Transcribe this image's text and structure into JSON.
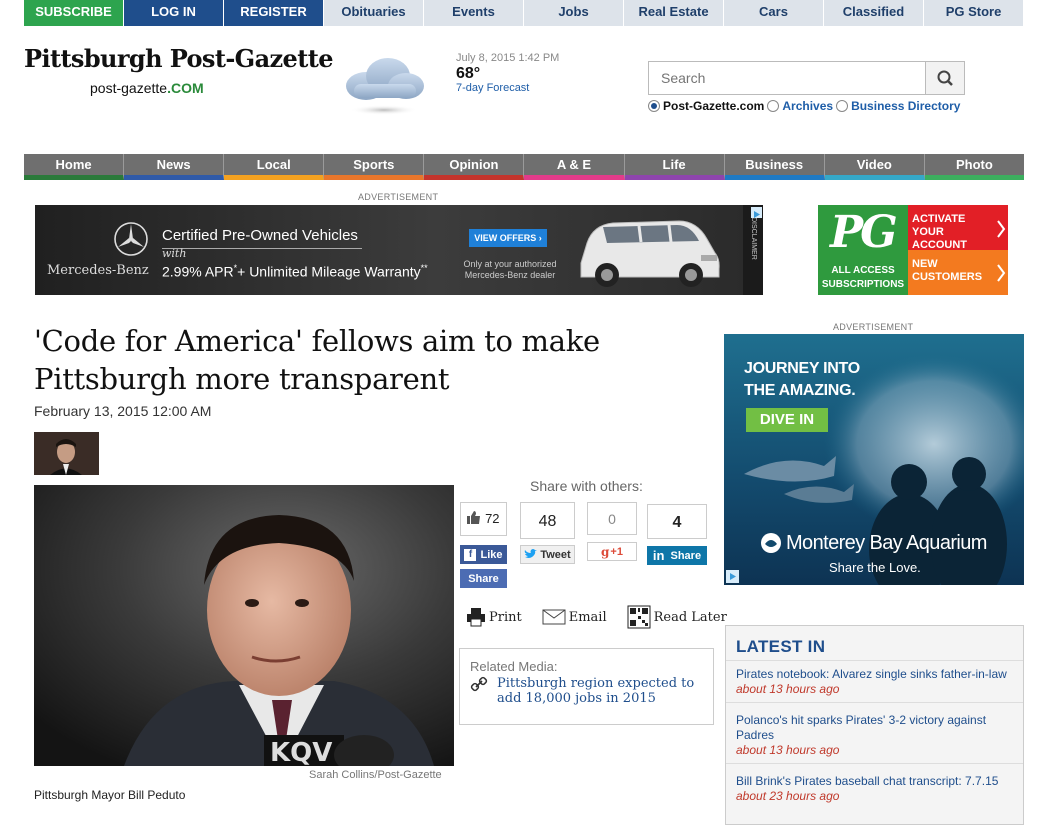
{
  "topnav": {
    "items": [
      "SUBSCRIBE",
      "LOG IN",
      "REGISTER",
      "Obituaries",
      "Events",
      "Jobs",
      "Real Estate",
      "Cars",
      "Classified",
      "PG Store"
    ]
  },
  "masthead": {
    "logo_text": "Pittsburgh Post-Gazette",
    "domain_prefix": "post-gazette",
    "domain_suffix": ".COM"
  },
  "weather": {
    "datetime": "July 8, 2015 1:42 PM",
    "temp": "68°",
    "forecast_link": "7-day Forecast",
    "icon": "cloud-icon"
  },
  "search": {
    "placeholder": "Search",
    "options": [
      {
        "label": "Post-Gazette.com",
        "selected": true
      },
      {
        "label": "Archives",
        "selected": false
      },
      {
        "label": "Business Directory",
        "selected": false
      }
    ]
  },
  "mainnav": {
    "items": [
      "Home",
      "News",
      "Local",
      "Sports",
      "Opinion",
      "A & E",
      "Life",
      "Business",
      "Video",
      "Photo"
    ],
    "colors": [
      "#2a7a3a",
      "#2f5aa8",
      "#f3a120",
      "#e8762b",
      "#c4342c",
      "#e23b8a",
      "#8e44ad",
      "#1f7ac4",
      "#35a8c8",
      "#3cae5e"
    ]
  },
  "ads": {
    "label": "ADVERTISEMENT",
    "mercedes": {
      "brand": "Mercedes-Benz",
      "line1": "Certified Pre-Owned Vehicles",
      "with": "with",
      "rate": "2.99% APR",
      "rate_mark": "*",
      "line3": "+ Unlimited Mileage Warranty",
      "stars": "**",
      "cta": "VIEW OFFERS ›",
      "dealer": "Only at your authorized Mercedes-Benz dealer",
      "disclaimer": "DISCLAIMER"
    },
    "pg_access": {
      "logo": "PG",
      "all_access": "ALL ACCESS",
      "subscriptions": "SUBSCRIPTIONS",
      "activate": "ACTIVATE YOUR ACCOUNT",
      "new": "NEW CUSTOMERS"
    },
    "aquarium": {
      "line1": "JOURNEY INTO",
      "line2": "THE AMAZING.",
      "cta": "DIVE IN",
      "name": "Monterey Bay Aquarium",
      "tagline": "Share the Love."
    }
  },
  "article": {
    "headline": "'Code for America' fellows aim to make Pittsburgh more transparent",
    "date": "February 13, 2015 12:00 AM",
    "photo_credit": "Sarah Collins/Post-Gazette",
    "caption": "Pittsburgh Mayor Bill Peduto",
    "photo_text": "KQV"
  },
  "share": {
    "header": "Share with others:",
    "facebook_count": "72",
    "facebook_like": "Like",
    "facebook_share": "Share",
    "twitter_count": "48",
    "twitter_label": "Tweet",
    "gplus_count": "0",
    "gplus_label": "+1",
    "linkedin_count": "4",
    "linkedin_label": "Share"
  },
  "tools": {
    "print": "Print",
    "email": "Email",
    "read_later": "Read Later"
  },
  "related": {
    "header": "Related Media:",
    "link": "Pittsburgh region expected to add 18,000 jobs in 2015"
  },
  "latest": {
    "header": "LATEST IN",
    "items": [
      {
        "title": "Pirates notebook: Alvarez single sinks father-in-law",
        "ago": "about 13 hours ago"
      },
      {
        "title": "Polanco's hit sparks Pirates' 3-2 victory against Padres",
        "ago": "about 13 hours ago"
      },
      {
        "title": "Bill Brink's Pirates baseball chat transcript: 7.7.15",
        "ago": "about 23 hours ago"
      }
    ]
  }
}
